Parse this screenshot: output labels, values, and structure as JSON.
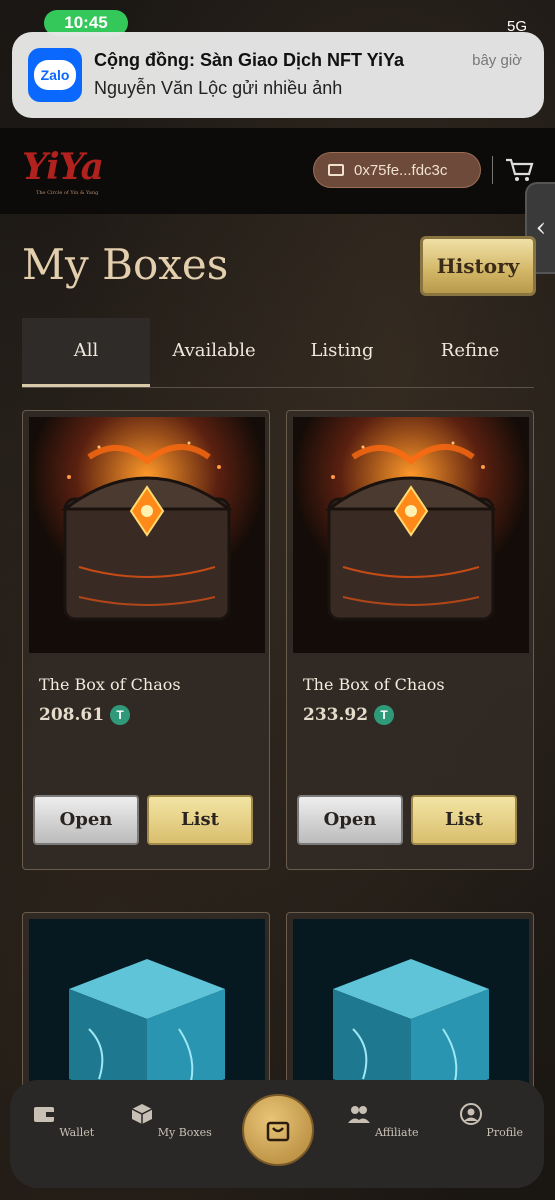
{
  "status_bar": {
    "time": "10:45",
    "network": "5G"
  },
  "notification": {
    "app_name": "Zalo",
    "title": "Cộng đồng: Sàn Giao Dịch NFT YiYa",
    "body": "Nguyễn Văn Lộc gửi nhiều ảnh",
    "time": "bây giờ"
  },
  "header": {
    "brand": "YiYa",
    "tagline": "The Circle of Yin & Yang",
    "wallet_address": "0x75fe...fdc3c"
  },
  "page": {
    "title": "My Boxes",
    "history_label": "History"
  },
  "tabs": [
    {
      "label": "All",
      "active": true
    },
    {
      "label": "Available",
      "active": false
    },
    {
      "label": "Listing",
      "active": false
    },
    {
      "label": "Refine",
      "active": false
    }
  ],
  "boxes": [
    {
      "name": "The Box of Chaos",
      "price": "208.61",
      "currency_icon": "T",
      "open_label": "Open",
      "list_label": "List"
    },
    {
      "name": "The Box of Chaos",
      "price": "233.92",
      "currency_icon": "T",
      "open_label": "Open",
      "list_label": "List"
    }
  ],
  "bottom_nav": [
    {
      "label": "Wallet",
      "icon": "wallet-icon"
    },
    {
      "label": "My Boxes",
      "icon": "box-icon"
    },
    {
      "label": "",
      "icon": "shopping-bag-icon"
    },
    {
      "label": "Affiliate",
      "icon": "users-icon"
    },
    {
      "label": "Profile",
      "icon": "profile-icon"
    }
  ],
  "colors": {
    "accent_gold": "#d9bf6e",
    "brand_red": "#b1211d",
    "wallet_bg": "#6e4a3a"
  }
}
